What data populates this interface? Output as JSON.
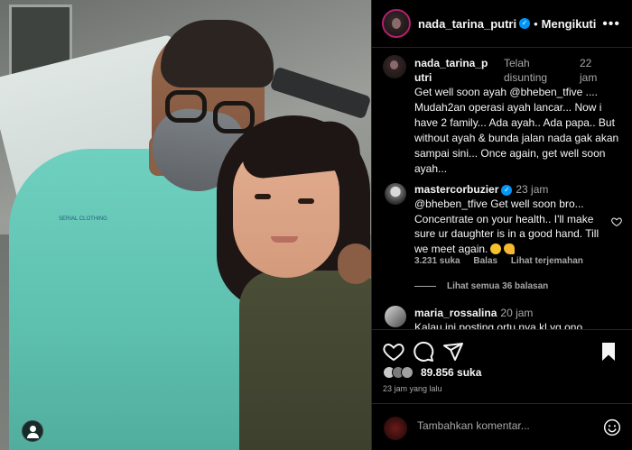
{
  "post": {
    "gown_print": "SERIAL CLOTHING"
  },
  "header": {
    "username": "nada_tarina_putri",
    "separator": "•",
    "follow_label": "Mengikuti",
    "more_label": "•••"
  },
  "caption": {
    "username": "nada_tarina_putri",
    "edited_label": "Telah disunting",
    "time_ago": "22 jam",
    "text": "Get well soon ayah @bheben_tfive .... Mudah2an operasi ayah lancar... Now i have 2 family... Ada ayah.. Ada papa.. But without ayah & bunda jalan nada gak akan sampai sini... Once again, get well soon ayah..."
  },
  "comments": [
    {
      "username": "mastercorbuzier",
      "time_ago": "23 jam",
      "text": "@bheben_tfive Get well soon bro... Concentrate on your health.. I'll make sure ur daughter is in a good hand. Till we meet again.",
      "likes": "3.231 suka",
      "reply_label": "Balas",
      "translate_label": "Lihat terjemahan",
      "view_replies": "Lihat semua 36 balasan"
    },
    {
      "username": "maria_rossalina",
      "time_ago": "20 jam",
      "text": "Kalau ini posting ortu nya.kl yg ono"
    }
  ],
  "actions": {
    "likes_count": "89.856 suka",
    "date": "23 jam yang lalu"
  },
  "add_comment": {
    "placeholder": "Tambahkan komentar..."
  },
  "icons": [
    "heart-icon",
    "comment-icon",
    "share-icon",
    "bookmark-icon",
    "emoji-icon",
    "more-icon",
    "verified-icon",
    "user-tag-icon"
  ],
  "colors": {
    "background": "#000000",
    "text": "#f5f5f5",
    "secondary_text": "#a8a8a8",
    "verified_blue": "#0095f6",
    "divider": "#262626"
  }
}
